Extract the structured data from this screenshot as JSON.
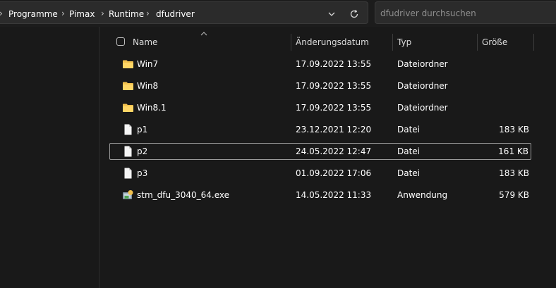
{
  "breadcrumb": {
    "items": [
      "Programme",
      "Pimax",
      "Runtime",
      "dfudriver"
    ]
  },
  "search": {
    "placeholder": "dfudriver durchsuchen"
  },
  "columns": {
    "name": "Name",
    "date": "Änderungsdatum",
    "type": "Typ",
    "size": "Größe"
  },
  "files": [
    {
      "name": "Win7",
      "date": "17.09.2022 13:55",
      "type": "Dateiordner",
      "size": "",
      "icon": "folder-icon"
    },
    {
      "name": "Win8",
      "date": "17.09.2022 13:55",
      "type": "Dateiordner",
      "size": "",
      "icon": "folder-icon"
    },
    {
      "name": "Win8.1",
      "date": "17.09.2022 13:55",
      "type": "Dateiordner",
      "size": "",
      "icon": "folder-icon"
    },
    {
      "name": "p1",
      "date": "23.12.2021 12:20",
      "type": "Datei",
      "size": "183 KB",
      "icon": "file-icon"
    },
    {
      "name": "p2",
      "date": "24.05.2022 12:47",
      "type": "Datei",
      "size": "161 KB",
      "icon": "file-icon",
      "selected": true
    },
    {
      "name": "p3",
      "date": "01.09.2022 17:06",
      "type": "Datei",
      "size": "183 KB",
      "icon": "file-icon"
    },
    {
      "name": "stm_dfu_3040_64.exe",
      "date": "14.05.2022 11:33",
      "type": "Anwendung",
      "size": "579 KB",
      "icon": "installer-icon"
    }
  ],
  "colors": {
    "background": "#191919",
    "folder": "#f2c14e",
    "selection_border": "#9a9a9a"
  }
}
